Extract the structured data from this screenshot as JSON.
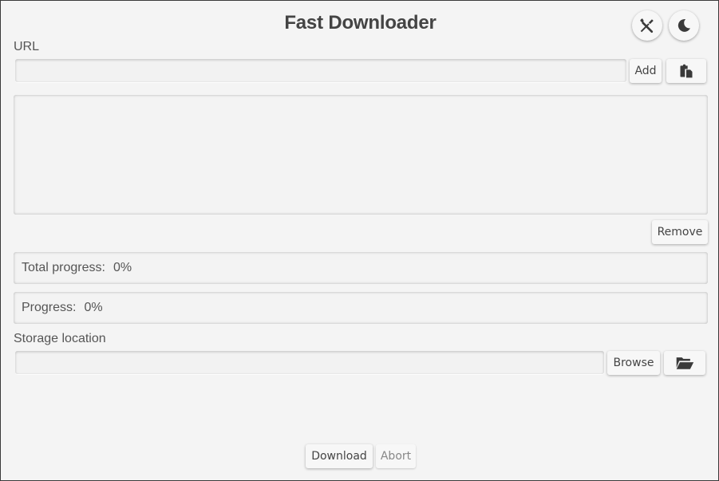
{
  "app": {
    "title": "Fast Downloader"
  },
  "header": {
    "settings_icon": "tools-icon",
    "theme_icon": "moon-icon"
  },
  "url_section": {
    "label": "URL",
    "input_value": "",
    "add_label": "Add",
    "paste_icon": "clipboard-icon"
  },
  "url_list": {
    "items": [],
    "remove_label": "Remove"
  },
  "progress": {
    "total_label": "Total progress:",
    "total_value": "0%",
    "total_fraction": 0,
    "current_label": "Progress:",
    "current_value": "0%",
    "current_fraction": 0
  },
  "storage": {
    "label": "Storage location",
    "input_value": "",
    "browse_label": "Browse",
    "folder_icon": "folder-open-icon"
  },
  "footer": {
    "download_label": "Download",
    "abort_label": "Abort"
  },
  "colors": {
    "background": "#f4f4f4",
    "text": "#4a4a4a"
  }
}
